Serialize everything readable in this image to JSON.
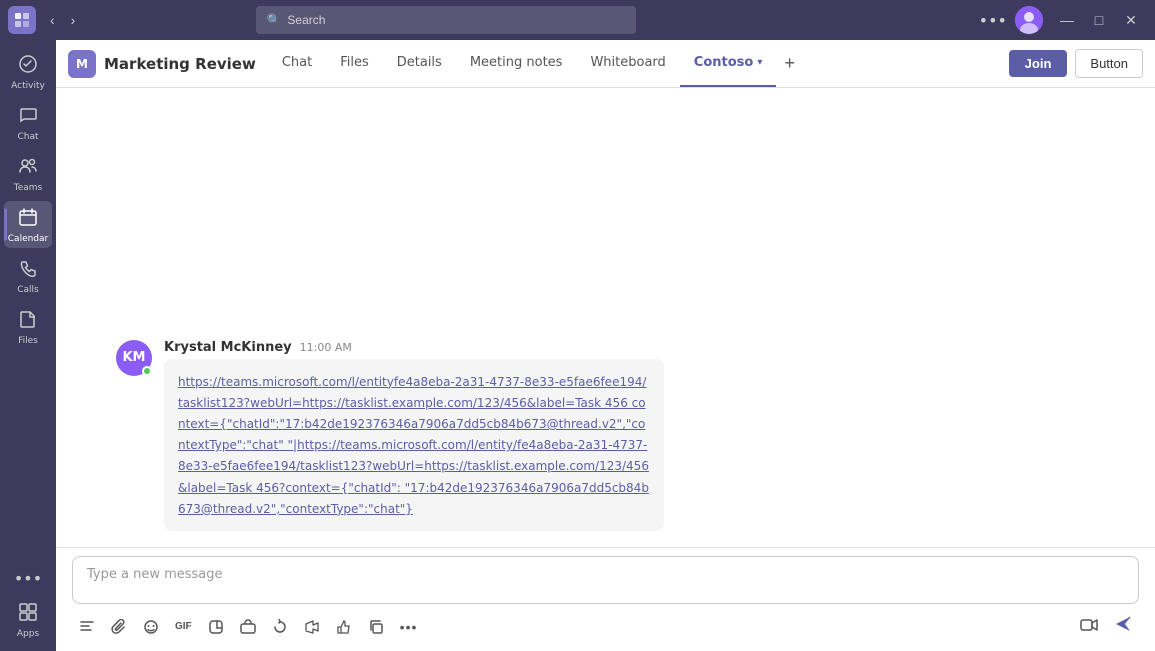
{
  "titleBar": {
    "appIcon": "T",
    "searchPlaceholder": "Search",
    "windowControls": {
      "minimize": "─",
      "maximize": "□",
      "close": "✕"
    }
  },
  "sidebar": {
    "items": [
      {
        "id": "activity",
        "label": "Activity",
        "icon": "🔔"
      },
      {
        "id": "chat",
        "label": "Chat",
        "icon": "💬"
      },
      {
        "id": "teams",
        "label": "Teams",
        "icon": "👥"
      },
      {
        "id": "calendar",
        "label": "Calendar",
        "icon": "📅"
      },
      {
        "id": "calls",
        "label": "Calls",
        "icon": "📞"
      },
      {
        "id": "files",
        "label": "Files",
        "icon": "📄"
      }
    ],
    "moreLabel": "•••",
    "appsLabel": "Apps",
    "activeItem": "calendar"
  },
  "channel": {
    "icon": "M",
    "title": "Marketing Review",
    "tabs": [
      {
        "id": "chat",
        "label": "Chat",
        "active": false
      },
      {
        "id": "files",
        "label": "Files",
        "active": false
      },
      {
        "id": "details",
        "label": "Details",
        "active": false
      },
      {
        "id": "meeting-notes",
        "label": "Meeting notes",
        "active": false
      },
      {
        "id": "whiteboard",
        "label": "Whiteboard",
        "active": false
      },
      {
        "id": "contoso",
        "label": "Contoso",
        "active": true
      }
    ],
    "addTabLabel": "+",
    "joinButton": "Join",
    "actionButton": "Button"
  },
  "chat": {
    "messages": [
      {
        "id": "msg1",
        "author": "Krystal McKinney",
        "authorInitials": "KM",
        "time": "11:00 AM",
        "links": [
          "https://teams.microsoft.com/l/entityfe4a8eba-2a31-4737-8e33-e5fae6fee194/tasklist123?webUrl=https://tasklist.example.com/123/456&label=Task 456 context={\"chatId\":\"17:b42de192376346a7906a7dd5cb84b673@thread.v2\",\"contextType\":\"chat\"|https://teams.microsoft.com/l/entity/fe4a8eba-2a31-4737-8e33-e5fae6fee194/tasklist123?webUrl=https://tasklist.example.com/123/456&label=Task 456?context={\"chatId\":\"17:b42de192376346a7906a7dd5cb84b673@thread.v2\",\"contextType\":\"chat\"}"
        ]
      }
    ]
  },
  "compose": {
    "placeholder": "Type a new message",
    "toolbar": [
      {
        "id": "format",
        "icon": "✏️",
        "label": "Format"
      },
      {
        "id": "attach",
        "icon": "📎",
        "label": "Attach"
      },
      {
        "id": "emoji",
        "icon": "😊",
        "label": "Emoji"
      },
      {
        "id": "giphy",
        "icon": "GIF",
        "label": "Giphy"
      },
      {
        "id": "sticker",
        "icon": "🗒",
        "label": "Sticker"
      },
      {
        "id": "schedule",
        "icon": "📋",
        "label": "Message extension"
      },
      {
        "id": "like",
        "icon": "👍",
        "label": "Like"
      },
      {
        "id": "loop",
        "icon": "🔄",
        "label": "Loop"
      },
      {
        "id": "forward",
        "icon": "↪",
        "label": "Forward"
      },
      {
        "id": "copy",
        "icon": "📋",
        "label": "Copy"
      },
      {
        "id": "more",
        "icon": "•••",
        "label": "More options"
      }
    ],
    "sendIcon": "➤",
    "videoIcon": "📷"
  }
}
